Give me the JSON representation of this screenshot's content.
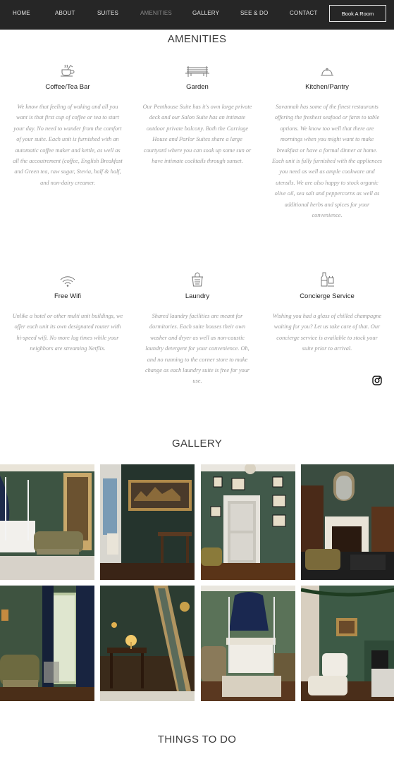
{
  "nav": {
    "items": [
      {
        "label": "HOME",
        "active": false
      },
      {
        "label": "ABOUT",
        "active": false
      },
      {
        "label": "SUITES",
        "active": false
      },
      {
        "label": "AMENITIES",
        "active": true
      },
      {
        "label": "GALLERY",
        "active": false
      },
      {
        "label": "SEE & DO",
        "active": false
      },
      {
        "label": "CONTACT",
        "active": false
      }
    ],
    "book_label": "Book A Room"
  },
  "amenities": {
    "title": "AMENITIES",
    "items": [
      {
        "icon": "coffee-tea-icon",
        "name": "Coffee/Tea Bar",
        "desc": "We know that feeling of waking and all you want is that first cup of coffee or tea to start your day.  No need to wander from the comfort of your suite.  Each unit is furnished with an automatic coffee maker and kettle, as well as all the accoutrement (coffee, English Breakfast and Green tea, raw sugar, Stevia, half & half, and non-dairy creamer."
      },
      {
        "icon": "garden-bench-icon",
        "name": "Garden",
        "desc": "Our Penthouse Suite has it's own large private deck and our Salon Suite has an intimate outdoor private balcony.  Both the Carriage House and Parlor Suites share a large courtyard where you can soak up some sun or have intimate cocktails through sunset."
      },
      {
        "icon": "cloche-icon",
        "name": "Kitchen/Pantry",
        "desc": "Savannah has some of the finest restaurants offering the freshest seafood or farm to table options.  We know too well that there are mornings when you might want to make breakfast or have a formal dinner at home.  Each unit is fully furnished with the appliences you need as well as ample cookware and utensils.  We are also happy to stock organic olive oil, sea salt and peppercorns as well as additional herbs and spices for your convenience."
      },
      {
        "icon": "wifi-icon",
        "name": "Free Wifi",
        "desc": "Unlike a hotel or other multi unit buildings, we offer each unit its own designated router with hi-speed wifi.  No more lag times while your neighbors are streaming Netflix."
      },
      {
        "icon": "laundry-basket-icon",
        "name": "Laundry",
        "desc": "Shared laundry facilities are meant for dormitories.  Each suite houses their own washer and dryer as well as non-caustic laundry detergent for your convenience.  Oh, and no running to the corner store to make change as each laundry suite is free for your use."
      },
      {
        "icon": "champagne-icon",
        "name": "Concierge Service",
        "desc": "Wishing you had a glass of chilled champagne waiting for you? Let us take care of that.  Our concierge service is available to stock your suite prior to arrival."
      }
    ]
  },
  "social": {
    "icon": "instagram-icon"
  },
  "gallery": {
    "title": "GALLERY",
    "photos": [
      {
        "subject": "bedroom with white canopy bed and sofa"
      },
      {
        "subject": "dark green room with framed painting and desk"
      },
      {
        "subject": "green wall with framed prints, white door and chandelier"
      },
      {
        "subject": "living room with fireplace, mirror and armchairs"
      },
      {
        "subject": "chaise lounge by window with curtains"
      },
      {
        "subject": "desk with lamps and tall mirror"
      },
      {
        "subject": "canopy bed with navy drapes"
      },
      {
        "subject": "green living room with garland and fireplace"
      }
    ]
  },
  "things_to_do": {
    "title": "THINGS TO DO"
  },
  "colors": {
    "nav_bg": "#262626",
    "text": "#333333",
    "desc": "#9a9a9a",
    "accent_green": "#3f5a46"
  }
}
